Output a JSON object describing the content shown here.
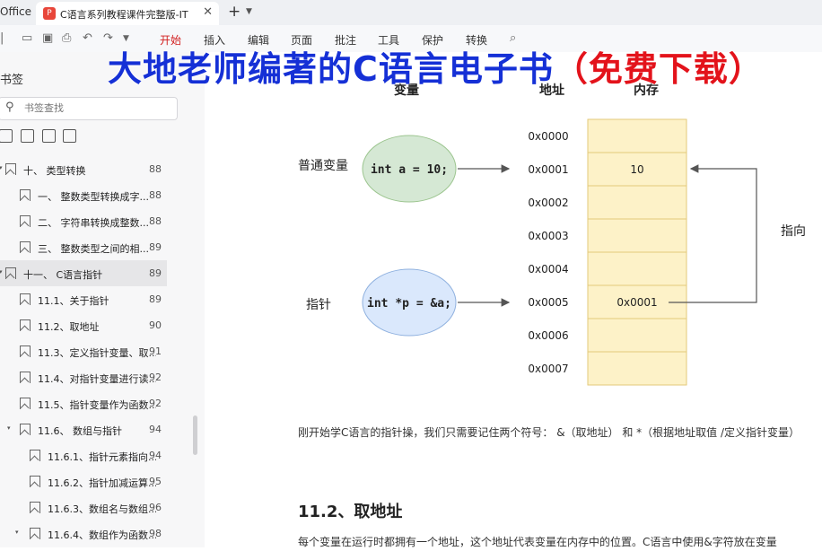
{
  "app": {
    "name": "Office"
  },
  "tab": {
    "title": "C语言系列教程课件完整版-IT",
    "new_tab": "+",
    "close": "✕"
  },
  "toolbar": {
    "menus": [
      "开始",
      "插入",
      "编辑",
      "页面",
      "批注",
      "工具",
      "保护",
      "转换"
    ],
    "active_index": 0
  },
  "banner": {
    "main": "大地老师编著的C语言电子书",
    "highlight": "（免费下载）"
  },
  "sidebar": {
    "title": "书签",
    "search_placeholder": "书签查找",
    "items": [
      {
        "label": "十、 类型转换",
        "page": "88",
        "level": 0,
        "arrow": "▾",
        "selected": false
      },
      {
        "label": "一、 整数类型转换成字...",
        "page": "88",
        "level": 1,
        "arrow": "",
        "selected": false
      },
      {
        "label": "二、 字符串转换成整数...",
        "page": "88",
        "level": 1,
        "arrow": "",
        "selected": false
      },
      {
        "label": "三、 整数类型之间的相...",
        "page": "89",
        "level": 1,
        "arrow": "",
        "selected": false
      },
      {
        "label": "十一、 C语言指针",
        "page": "89",
        "level": 0,
        "arrow": "▾",
        "selected": true
      },
      {
        "label": "11.1、关于指针",
        "page": "89",
        "level": 1,
        "arrow": "",
        "selected": false
      },
      {
        "label": "11.2、取地址",
        "page": "90",
        "level": 1,
        "arrow": "",
        "selected": false
      },
      {
        "label": "11.3、定义指针变量、取...",
        "page": "91",
        "level": 1,
        "arrow": "",
        "selected": false
      },
      {
        "label": "11.4、对指针变量进行读...",
        "page": "92",
        "level": 1,
        "arrow": "",
        "selected": false
      },
      {
        "label": "11.5、指针变量作为函数...",
        "page": "92",
        "level": 1,
        "arrow": "",
        "selected": false
      },
      {
        "label": "11.6、 数组与指针",
        "page": "94",
        "level": 1,
        "arrow": "▾",
        "selected": false
      },
      {
        "label": "11.6.1、指针元素指向...",
        "page": "94",
        "level": 2,
        "arrow": "",
        "selected": false
      },
      {
        "label": "11.6.2、指针加减运算...",
        "page": "95",
        "level": 2,
        "arrow": "",
        "selected": false
      },
      {
        "label": "11.6.3、数组名与数组...",
        "page": "96",
        "level": 2,
        "arrow": "",
        "selected": false
      },
      {
        "label": "11.6.4、数组作为函数...",
        "page": "98",
        "level": 2,
        "arrow": "▾",
        "selected": false
      }
    ]
  },
  "diagram": {
    "headers": {
      "variable": "变量",
      "address": "地址",
      "memory": "内存"
    },
    "normal_var_label": "普通变量",
    "normal_var_code": "int a = 10;",
    "pointer_label": "指针",
    "pointer_code": "int *p = &a;",
    "addresses": [
      "0x0000",
      "0x0001",
      "0x0002",
      "0x0003",
      "0x0004",
      "0x0005",
      "0x0006",
      "0x0007"
    ],
    "memory": [
      "",
      "10",
      "",
      "",
      "",
      "0x0001",
      "",
      ""
    ],
    "points_to_label": "指向",
    "colors": {
      "cell_fill": "#fdf2c8",
      "cell_border": "#e3c97a",
      "normal_oval": "#d5e8d4",
      "pointer_oval": "#dae8fc"
    }
  },
  "content": {
    "paragraph": "刚开始学C语言的指针操，我们只需要记住两个符号： &（取地址） 和 *（根据地址取值 /定义指针变量）",
    "heading": "11.2、取地址",
    "paragraph2": "每个变量在运行时都拥有一个地址，这个地址代表变量在内存中的位置。C语言中使用&字符放在变量"
  }
}
